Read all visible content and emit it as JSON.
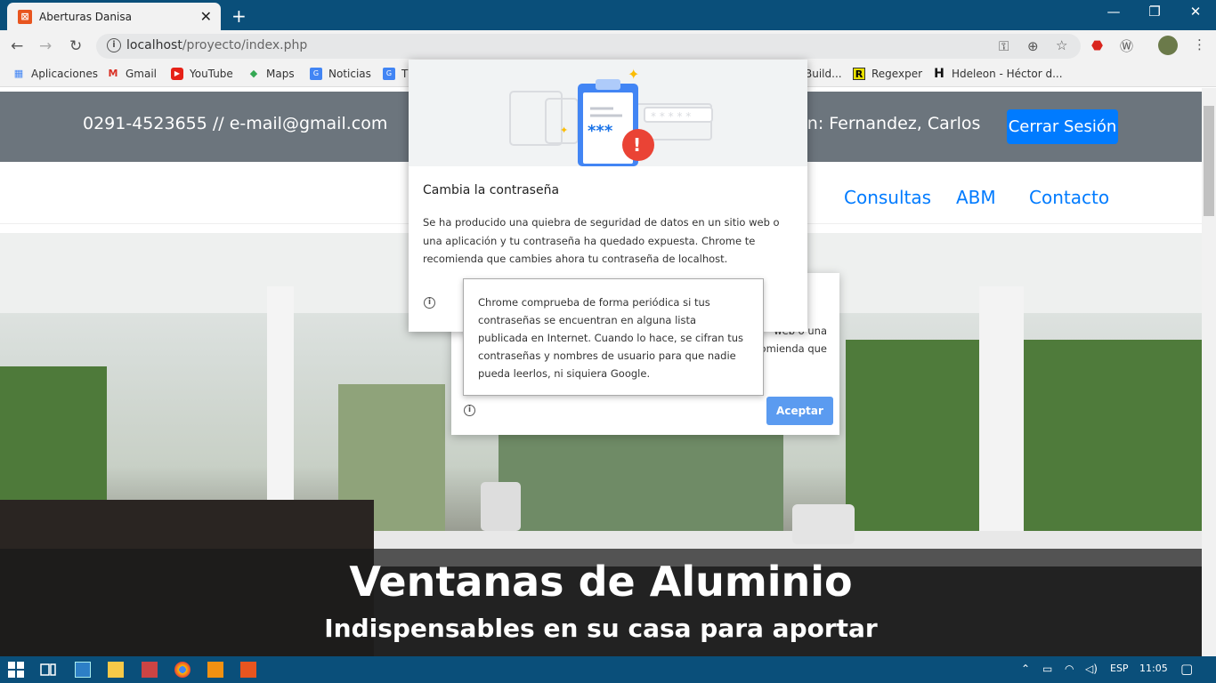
{
  "browser": {
    "tab_title": "Aberturas Danisa",
    "url_host": "localhost",
    "url_path": "/proyecto/index.php",
    "bookmarks": [
      "Aplicaciones",
      "Gmail",
      "YouTube",
      "Maps",
      "Noticias",
      "T",
      "Build...",
      "Regexper",
      "Hdeleon - Héctor d..."
    ]
  },
  "site": {
    "phone_email": "0291-4523655 // e-mail@gmail.com",
    "session_text": "sión: Fernandez, Carlos",
    "logout_label": "Cerrar Sesión",
    "nav": [
      "Consultas",
      "ABM",
      "Contacto"
    ],
    "hero_title": "Ventanas de Aluminio",
    "hero_subtitle": "Indispensables en su casa para aportar"
  },
  "password_dialog": {
    "title": "Cambia la contraseña",
    "body": "Se ha producido una quiebra de seguridad de datos en un sitio web o una aplicación y tu contraseña ha quedado expuesta. Chrome te recomienda que cambies ahora tu contraseña de localhost.",
    "stars": "***",
    "bg_snippet1": "web o una",
    "bg_snippet2": "omienda que",
    "accept_label": "Aceptar",
    "tooltip": "Chrome comprueba de forma periódica si tus contraseñas se encuentran en alguna lista publicada en Internet. Cuando lo hace, se cifran tus contraseñas y nombres de usuario para que nadie pueda leerlos, ni siquiera Google."
  },
  "taskbar": {
    "lang": "ESP",
    "time": "11:05"
  },
  "colors": {
    "titlebar": "#0a4f7a",
    "primary": "#007bff",
    "topbar": "#6c757d"
  }
}
